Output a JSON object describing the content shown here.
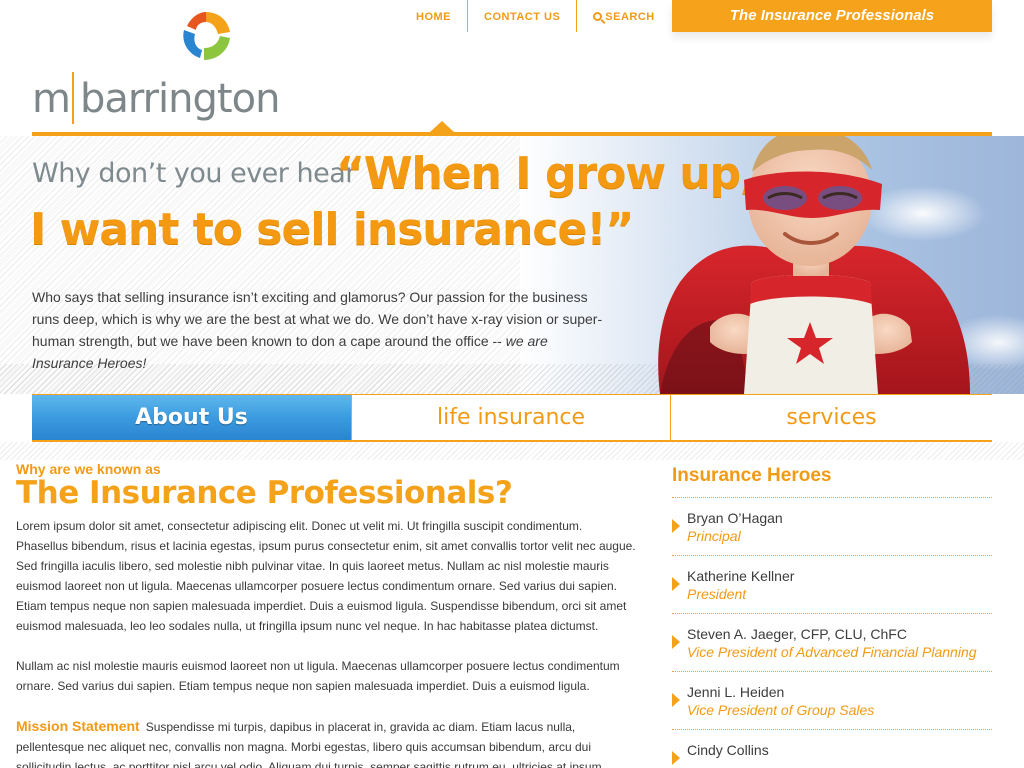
{
  "brand": {
    "logo_text_m": "m",
    "logo_text_rest": "barrington",
    "tagline": "The Insurance Professionals",
    "colors": {
      "accent": "#f5a21b",
      "accent_dark": "#f29a14",
      "tab_active": "#3c9be0",
      "text": "#3a3a3a",
      "muted": "#7f8a8e"
    }
  },
  "topnav": {
    "items": [
      {
        "label": "HOME"
      },
      {
        "label": "CONTACT US"
      },
      {
        "label": "SEARCH",
        "icon": "search-icon"
      }
    ]
  },
  "hero": {
    "lead": "Why don’t you ever hear",
    "quote_line1": "“When I grow up,",
    "quote_line2": "I want to sell insurance!”",
    "intro_part1": "Who says that selling insurance isn’t exciting and glamorus? Our passion  for the business runs deep, which is why we are the best at what we do. We don’t have x-ray vision or super-human strength, but we have been known to don a cape around the office -- ",
    "intro_em": "we are Insurance Heroes!",
    "image": "superhero-kid-photo"
  },
  "tabs": [
    {
      "label": "About Us",
      "active": true
    },
    {
      "label": "life insurance",
      "active": false
    },
    {
      "label": "services",
      "active": false
    }
  ],
  "main": {
    "kicker": "Why are we known as",
    "heading": "The Insurance Professionals?",
    "para1": "Lorem ipsum dolor sit amet, consectetur adipiscing elit. Donec ut velit mi. Ut fringilla suscipit condimentum. Phasellus bibendum, risus et lacinia egestas, ipsum purus consectetur enim, sit amet convallis tortor velit nec augue. Sed fringilla iaculis libero, sed molestie nibh pulvinar vitae. In quis laoreet metus. Nullam ac nisl molestie mauris euismod laoreet non ut ligula. Maecenas ullamcorper posuere lectus condimentum ornare. Sed varius dui sapien. Etiam tempus neque non sapien malesuada imperdiet. Duis a euismod ligula. Suspendisse bibendum, orci sit amet euismod malesuada, leo leo sodales nulla, ut fringilla ipsum nunc vel neque. In hac habitasse platea dictumst.",
    "para2": "Nullam ac nisl molestie mauris euismod laoreet non ut ligula. Maecenas ullamcorper posuere lectus condimentum ornare. Sed varius dui sapien. Etiam tempus neque non sapien malesuada imperdiet. Duis a euismod ligula.",
    "mission_label": "Mission Statement",
    "mission_text": "Suspendisse mi turpis, dapibus in placerat in, gravida ac diam. Etiam lacus nulla, pellentesque nec aliquet nec, convallis non magna. Morbi egestas, libero quis accumsan bibendum, arcu dui sollicitudin lectus, ac porttitor nisl arcu vel odio. Aliquam dui turpis, semper sagittis rutrum eu, ultricies at ipsum."
  },
  "sidebar": {
    "title": "Insurance Heroes",
    "people": [
      {
        "name": "Bryan O’Hagan",
        "title": "Principal"
      },
      {
        "name": "Katherine Kellner",
        "title": "President"
      },
      {
        "name": "Steven A. Jaeger, CFP, CLU, ChFC",
        "title": "Vice President of Advanced Financial Planning"
      },
      {
        "name": "Jenni L. Heiden",
        "title": "Vice President of Group Sales"
      },
      {
        "name": "Cindy Collins",
        "title": ""
      }
    ]
  }
}
